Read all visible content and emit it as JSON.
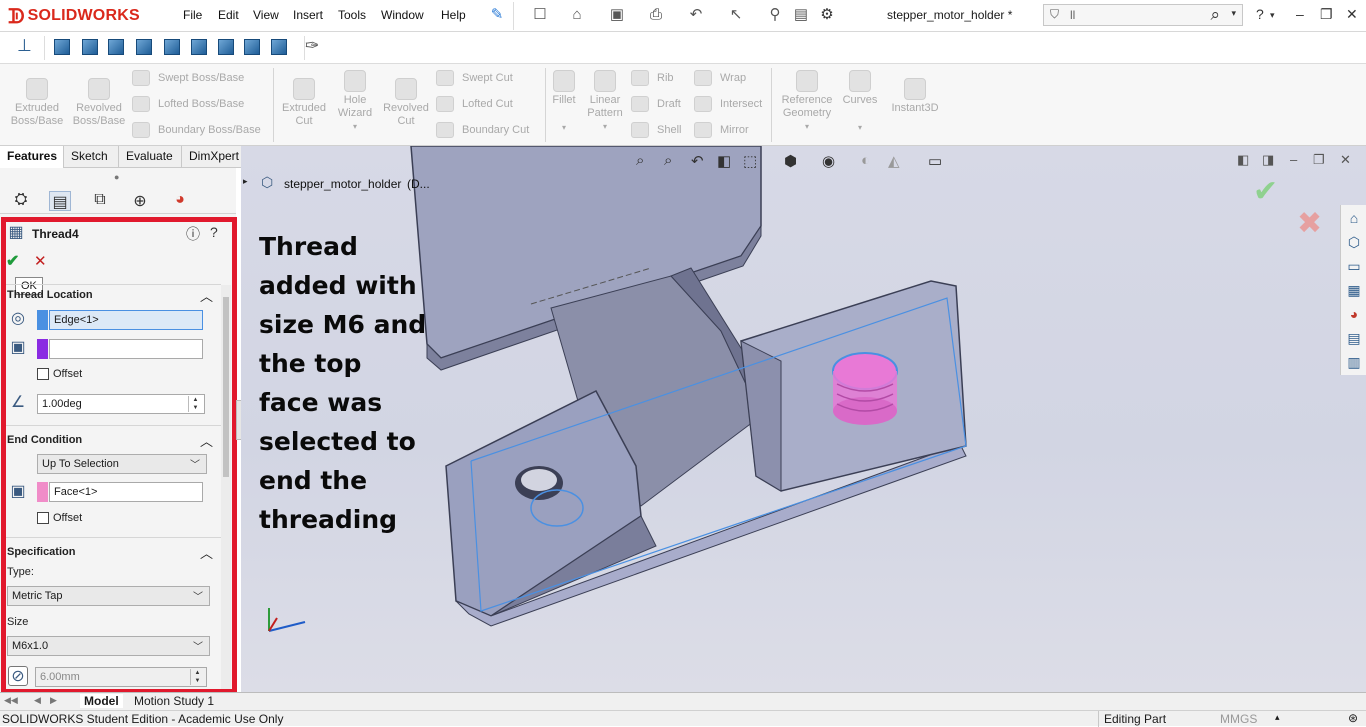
{
  "app": {
    "brand": "SOLIDWORKS",
    "document_title": "stepper_motor_holder *",
    "search_text": "ll"
  },
  "menu": [
    "File",
    "Edit",
    "View",
    "Insert",
    "Tools",
    "Window",
    "Help"
  ],
  "command_manager": {
    "features": {
      "extruded_boss": "Extruded Boss/Base",
      "revolved_boss": "Revolved Boss/Base",
      "swept_boss": "Swept Boss/Base",
      "lofted_boss": "Lofted Boss/Base",
      "boundary_boss": "Boundary Boss/Base",
      "extruded_cut": "Extruded Cut",
      "hole_wizard": "Hole Wizard",
      "revolved_cut": "Revolved Cut",
      "swept_cut": "Swept Cut",
      "lofted_cut": "Lofted Cut",
      "boundary_cut": "Boundary Cut",
      "fillet": "Fillet",
      "linear_pattern": "Linear Pattern",
      "rib": "Rib",
      "draft": "Draft",
      "shell": "Shell",
      "wrap": "Wrap",
      "intersect": "Intersect",
      "mirror": "Mirror",
      "reference_geometry": "Reference Geometry",
      "curves": "Curves",
      "instant3d": "Instant3D"
    }
  },
  "tabs": [
    "Features",
    "Sketch",
    "Evaluate",
    "DimXpert"
  ],
  "property_manager": {
    "title": "Thread4",
    "ok_tooltip": "OK",
    "thread_location": {
      "header": "Thread Location",
      "edge": "Edge<1>",
      "second": "",
      "offset_label": "Offset",
      "offset_checked": false,
      "angle": "1.00deg"
    },
    "end_condition": {
      "header": "End Condition",
      "type": "Up To Selection",
      "face": "Face<1>",
      "offset_label": "Offset",
      "offset_checked": false
    },
    "specification": {
      "header": "Specification",
      "type_label": "Type:",
      "type": "Metric Tap",
      "size_label": "Size",
      "size": "M6x1.0",
      "diameter": "6.00mm"
    }
  },
  "viewport": {
    "tree_item": "stepper_motor_holder",
    "tree_suffix": "(D...",
    "annotation": "Thread added with size M6 and the top face was selected to end the threading"
  },
  "bottom_tabs": [
    "Model",
    "Motion Study 1"
  ],
  "status": {
    "left": "SOLIDWORKS Student Edition - Academic Use Only",
    "mode": "Editing Part",
    "units": "MMGS"
  },
  "colors": {
    "brand_red": "#da291c",
    "highlight_box": "#e1192d",
    "edge_swatch": "#4a90e2",
    "second_swatch": "#8a2be2",
    "face_swatch": "#f08cc8",
    "thread_pink": "#e879d6"
  }
}
